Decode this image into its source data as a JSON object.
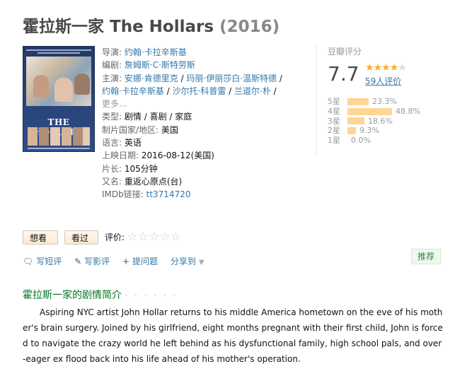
{
  "movie": {
    "title_cn": "霍拉斯一家",
    "title_en": "The Hollars",
    "year": "(2016)"
  },
  "poster": {
    "title_text": "THE HOLLARS"
  },
  "info": {
    "director_label": "导演:",
    "director": "约翰·卡拉辛斯基",
    "writer_label": "编剧:",
    "writer": "詹姆斯·C·斯特劳斯",
    "cast_label": "主演:",
    "cast": [
      "安娜·肯德里克",
      "玛丽·伊丽莎白·温斯特德",
      "约翰·卡拉辛斯基",
      "沙尔托·科普雷",
      "兰道尔·朴"
    ],
    "more": "更多...",
    "genre_label": "类型:",
    "genres": [
      "剧情",
      "喜剧",
      "家庭"
    ],
    "country_label": "制片国家/地区:",
    "country": "美国",
    "language_label": "语言:",
    "language": "英语",
    "release_label": "上映日期:",
    "release": "2016-08-12(美国)",
    "runtime_label": "片长:",
    "runtime": "105分钟",
    "aka_label": "又名:",
    "aka": "重返心原点(台)",
    "imdb_label": "IMDb链接:",
    "imdb": "tt3714720"
  },
  "rating": {
    "label": "豆瓣评分",
    "score": "7.7",
    "stars_filled": 4,
    "stars_total": 5,
    "votes": "59人评价",
    "distribution": [
      {
        "label": "5星",
        "percent": "23.3%",
        "value": 23.3
      },
      {
        "label": "4星",
        "percent": "48.8%",
        "value": 48.8
      },
      {
        "label": "3星",
        "percent": "18.6%",
        "value": 18.6
      },
      {
        "label": "2星",
        "percent": "9.3%",
        "value": 9.3
      },
      {
        "label": "1星",
        "percent": "0.0%",
        "value": 0.0
      }
    ]
  },
  "interest": {
    "want": "想看",
    "seen": "看过",
    "evaluate_label": "评价:",
    "stars": "☆☆☆☆☆"
  },
  "actions": {
    "short_review": "写短评",
    "review": "写影评",
    "ask": "提问题",
    "share": "分享到"
  },
  "recommend": "推荐",
  "synopsis": {
    "heading": "霍拉斯一家的剧情简介",
    "dots": "· · · · · ·",
    "text": "Aspiring NYC artist John Hollar returns to his middle America hometown on the eve of his mother's brain surgery. Joined by his girlfriend, eight months pregnant with their first child, John is forced to navigate the crazy world he left behind as his dysfunctional family, high school pals, and over-eager ex flood back into his life ahead of his mother's operation."
  },
  "colors": {
    "link": "#3377aa",
    "star": "#ffac2d",
    "bar": "#ffd596",
    "heading_green": "#007722"
  }
}
